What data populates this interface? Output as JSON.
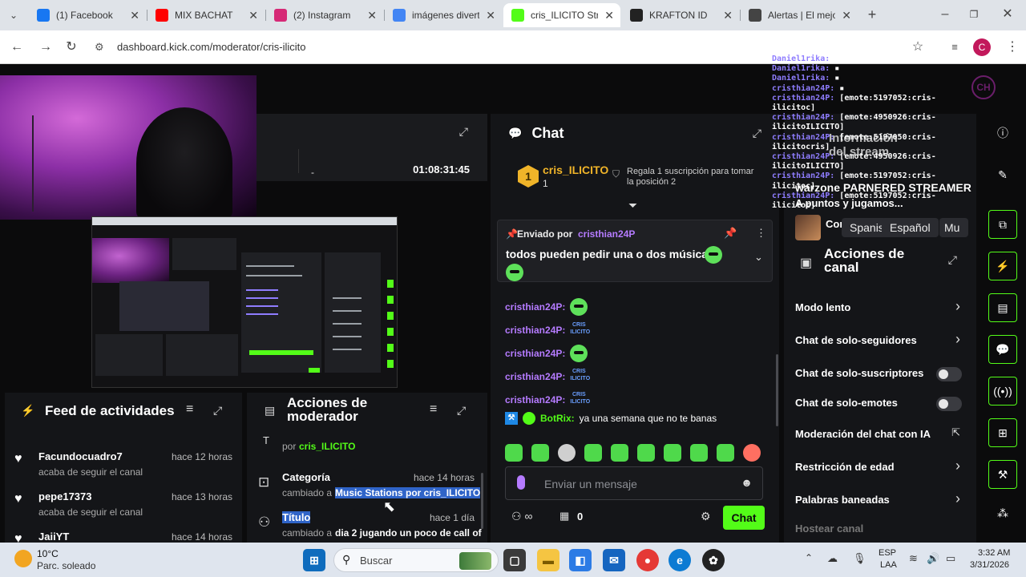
{
  "browser": {
    "tabs": [
      {
        "label": "(1) Facebook",
        "icon": "facebook-icon",
        "color": "#1877f2"
      },
      {
        "label": "MIX BACHAT",
        "icon": "youtube-icon",
        "color": "#ff0000"
      },
      {
        "label": "(2) Instagram",
        "icon": "instagram-icon",
        "color": "#d62976"
      },
      {
        "label": "imágenes divert",
        "icon": "google-icon",
        "color": "#4285f4"
      },
      {
        "label": "cris_ILICITO Stre",
        "icon": "kick-icon",
        "color": "#53fc18"
      },
      {
        "label": "KRAFTON ID",
        "icon": "krafton-icon",
        "color": "#222222"
      },
      {
        "label": "Alertas | El mejo",
        "icon": "alerts-icon",
        "color": "#444444"
      }
    ],
    "url": "dashboard.kick.com/moderator/cris-ilicito",
    "profile_initial": "C"
  },
  "info_panel": {
    "timer": "01:08:31:45"
  },
  "chat": {
    "title": "Chat",
    "top_supporter": {
      "rank": "1",
      "name": "cris_ILICITO",
      "count": "1",
      "gift_text": "Regala 1 suscripción para tomar la posición 2"
    },
    "pinned": {
      "sent_by_label": "Enviado por",
      "sender": "cristhian24P",
      "text": "todos pueden pedir una o dos músicas"
    },
    "messages": [
      {
        "user": "cristhian24P:",
        "emote": "face"
      },
      {
        "user": "cristhian24P:",
        "emote": "text",
        "emote_text": "CRIS ILICITO"
      },
      {
        "user": "cristhian24P:",
        "emote": "face"
      },
      {
        "user": "cristhian24P:",
        "emote": "text",
        "emote_text": "CRIS ILICITO"
      },
      {
        "user": "cristhian24P:",
        "emote": "text",
        "emote_text": "CRIS ILICITO"
      }
    ],
    "bot_message": {
      "user": "BotRix:",
      "text": "ya una semana que no te banas"
    },
    "input_placeholder": "Enviar un mensaje",
    "viewer_count": "0",
    "send_label": "Chat"
  },
  "overlay_log": [
    {
      "name": "Daniel1rika:",
      "text": " ▪"
    },
    {
      "name": "Daniel1rika:",
      "text": " ▪"
    },
    {
      "name": "Daniel1rika:",
      "text": " ▪"
    },
    {
      "name": "cristhian24P:",
      "text": " ▪"
    },
    {
      "name": "cristhian24P:",
      "text": " [emote:5197052:cris-"
    },
    {
      "name": "",
      "text": "ilicitoc]"
    },
    {
      "name": "cristhian24P:",
      "text": " [emote:4950926:cris-"
    },
    {
      "name": "",
      "text": "ilicitoILICITO]"
    },
    {
      "name": "cristhian24P:",
      "text": " [emote:5197050:cris-"
    },
    {
      "name": "",
      "text": "ilicitocris]"
    },
    {
      "name": "cristhian24P:",
      "text": " [emote:4950926:cris-"
    },
    {
      "name": "",
      "text": "ilicitoILICITO]"
    },
    {
      "name": "cristhian24P:",
      "text": " [emote:5197052:cris-"
    },
    {
      "name": "",
      "text": "ilicitoc]"
    },
    {
      "name": "cristhian24P:",
      "text": " [emote:5197052:cris-"
    },
    {
      "name": "",
      "text": "ilicitoc]"
    }
  ],
  "stream_info": {
    "title_fragment": "Información del stream",
    "stream_title": "warzone PARNERED STREAMER",
    "subtitle": "A puntos y jugamos...",
    "category": "Conversando",
    "languages": [
      "Spanish",
      "Español",
      "Mu"
    ]
  },
  "channel_actions": {
    "title": "Acciones de canal",
    "items": [
      {
        "label": "Modo lento",
        "control": "chevron"
      },
      {
        "label": "Chat de solo-seguidores",
        "control": "chevron"
      },
      {
        "label": "Chat de solo-suscriptores",
        "control": "toggle"
      },
      {
        "label": "Chat de solo-emotes",
        "control": "toggle"
      },
      {
        "label": "Moderación del chat con IA",
        "control": "external"
      },
      {
        "label": "Restricción de edad",
        "control": "chevron"
      },
      {
        "label": "Palabras baneadas",
        "control": "chevron"
      },
      {
        "label": "Hostear canal",
        "control": "none"
      }
    ]
  },
  "activity_feed": {
    "title": "Feed de actividades",
    "items": [
      {
        "name": "Facundocuadro7",
        "action": "acaba de seguir el canal",
        "time": "hace 12 horas"
      },
      {
        "name": "pepe17373",
        "action": "acaba de seguir el canal",
        "time": "hace 13 horas"
      },
      {
        "name": "JaiiYT",
        "action": "",
        "time": "hace 14 horas"
      }
    ]
  },
  "mod_actions": {
    "title": "Acciones de moderador",
    "top_by": "por",
    "top_user": "cris_ILICITO",
    "items": [
      {
        "label": "Categoría",
        "time": "hace 14 horas",
        "change_prefix": "cambiado a",
        "change_value": "Music Stations por cris_ILICITO"
      },
      {
        "label": "Título",
        "time": "hace 1 día",
        "change_prefix": "cambiado a",
        "change_value": "dia 2 jugando un poco de call of"
      }
    ]
  },
  "taskbar": {
    "weather_temp": "10°C",
    "weather_desc": "Parc. soleado",
    "search_placeholder": "Buscar",
    "lang_top": "ESP",
    "lang_bottom": "LAA",
    "time": "3:32 AM",
    "date": "3/31/2026"
  }
}
